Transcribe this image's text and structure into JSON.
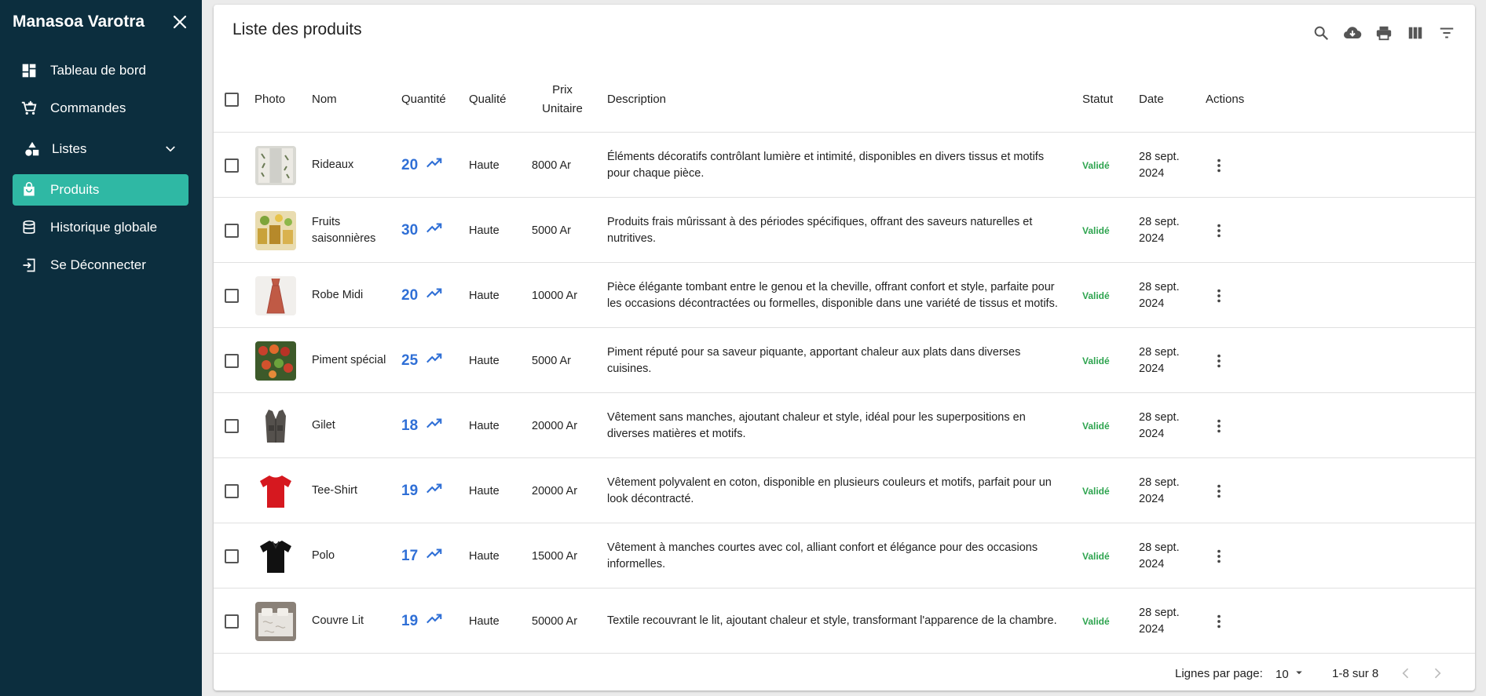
{
  "app": {
    "title": "Manasoa Varotra"
  },
  "sidebar": {
    "items": [
      {
        "label": "Tableau de bord",
        "icon": "dashboard-icon"
      },
      {
        "label": "Commandes",
        "icon": "cart-add-icon"
      },
      {
        "label": "Listes",
        "icon": "category-icon"
      },
      {
        "label": "Produits",
        "icon": "shopping-bag-icon",
        "active": true
      },
      {
        "label": "Historique globale",
        "icon": "database-icon"
      },
      {
        "label": "Se Déconnecter",
        "icon": "logout-icon"
      }
    ]
  },
  "page": {
    "title": "Liste des produits",
    "toolbar": [
      "search-icon",
      "download-cloud-icon",
      "print-icon",
      "columns-icon",
      "filter-icon"
    ]
  },
  "table": {
    "headers": {
      "photo": "Photo",
      "nom": "Nom",
      "quantite": "Quantité",
      "qualite": "Qualité",
      "prix_line1": "Prix",
      "prix_line2": "Unitaire",
      "description": "Description",
      "statut": "Statut",
      "date": "Date",
      "actions": "Actions"
    },
    "rows": [
      {
        "nom": "Rideaux",
        "quantite": "20",
        "qualite": "Haute",
        "prix": "8000 Ar",
        "description": "Éléments décoratifs contrôlant lumière et intimité, disponibles en divers tissus et motifs pour chaque pièce.",
        "statut": "Validé",
        "date_line1": "28 sept.",
        "date_line2": "2024"
      },
      {
        "nom": "Fruits saisonnières",
        "quantite": "30",
        "qualite": "Haute",
        "prix": "5000 Ar",
        "description": "Produits frais mûrissant à des périodes spécifiques, offrant des saveurs naturelles et nutritives.",
        "statut": "Validé",
        "date_line1": "28 sept.",
        "date_line2": "2024"
      },
      {
        "nom": "Robe Midi",
        "quantite": "20",
        "qualite": "Haute",
        "prix": "10000 Ar",
        "description": "Pièce élégante tombant entre le genou et la cheville, offrant confort et style, parfaite pour les occasions décontractées ou formelles, disponible dans une variété de tissus et motifs.",
        "statut": "Validé",
        "date_line1": "28 sept.",
        "date_line2": "2024"
      },
      {
        "nom": "Piment spécial",
        "quantite": "25",
        "qualite": "Haute",
        "prix": "5000 Ar",
        "description": "Piment réputé pour sa saveur piquante, apportant chaleur aux plats dans diverses cuisines.",
        "statut": "Validé",
        "date_line1": "28 sept.",
        "date_line2": "2024"
      },
      {
        "nom": "Gilet",
        "quantite": "18",
        "qualite": "Haute",
        "prix": "20000 Ar",
        "description": "Vêtement sans manches, ajoutant chaleur et style, idéal pour les superpositions en diverses matières et motifs.",
        "statut": "Validé",
        "date_line1": "28 sept.",
        "date_line2": "2024"
      },
      {
        "nom": "Tee-Shirt",
        "quantite": "19",
        "qualite": "Haute",
        "prix": "20000 Ar",
        "description": "Vêtement polyvalent en coton, disponible en plusieurs couleurs et motifs, parfait pour un look décontracté.",
        "statut": "Validé",
        "date_line1": "28 sept.",
        "date_line2": "2024"
      },
      {
        "nom": "Polo",
        "quantite": "17",
        "qualite": "Haute",
        "prix": "15000 Ar",
        "description": "Vêtement à manches courtes avec col, alliant confort et élégance pour des occasions informelles.",
        "statut": "Validé",
        "date_line1": "28 sept.",
        "date_line2": "2024"
      },
      {
        "nom": "Couvre Lit",
        "quantite": "19",
        "qualite": "Haute",
        "prix": "50000 Ar",
        "description": "Textile recouvrant le lit, ajoutant chaleur et style, transformant l'apparence de la chambre.",
        "statut": "Validé",
        "date_line1": "28 sept.",
        "date_line2": "2024"
      }
    ]
  },
  "pagination": {
    "rows_label": "Lignes par page:",
    "rows_value": "10",
    "range": "1-8 sur 8"
  },
  "colors": {
    "sidebar_bg": "#0c2e3e",
    "active_item": "#2fb8a4",
    "quantity": "#2f6fd6",
    "status_valid": "#2ea44f"
  }
}
